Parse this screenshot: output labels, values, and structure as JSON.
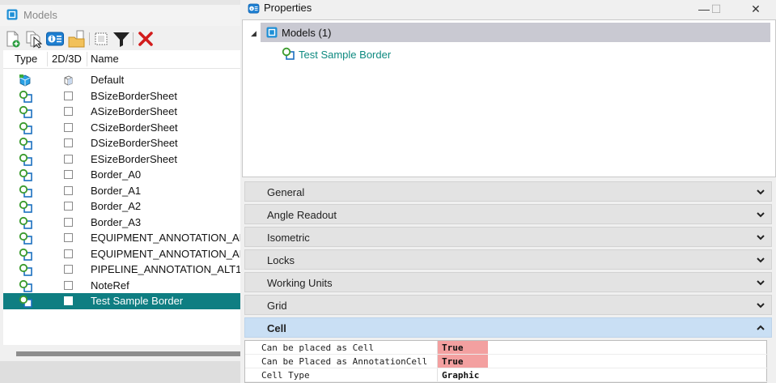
{
  "models_panel": {
    "title": "Models",
    "toolbar": {
      "icons": [
        "new-model-icon",
        "copy-model-icon",
        "properties-icon",
        "import-model-icon",
        "select-all-icon",
        "filter-icon",
        "delete-icon"
      ]
    },
    "columns": {
      "type": "Type",
      "dim": "2D/3D",
      "name": "Name"
    },
    "rows": [
      {
        "name": "Default",
        "type_icon": "design-model-3d-icon",
        "dim": "3d"
      },
      {
        "name": "BSizeBorderSheet",
        "type_icon": "sheet-model-icon",
        "dim": "2d"
      },
      {
        "name": "ASizeBorderSheet",
        "type_icon": "sheet-model-icon",
        "dim": "2d"
      },
      {
        "name": "CSizeBorderSheet",
        "type_icon": "sheet-model-icon",
        "dim": "2d"
      },
      {
        "name": "DSizeBorderSheet",
        "type_icon": "sheet-model-icon",
        "dim": "2d"
      },
      {
        "name": "ESizeBorderSheet",
        "type_icon": "sheet-model-icon",
        "dim": "2d"
      },
      {
        "name": "Border_A0",
        "type_icon": "sheet-model-icon",
        "dim": "2d"
      },
      {
        "name": "Border_A1",
        "type_icon": "sheet-model-icon",
        "dim": "2d"
      },
      {
        "name": "Border_A2",
        "type_icon": "sheet-model-icon",
        "dim": "2d"
      },
      {
        "name": "Border_A3",
        "type_icon": "sheet-model-icon",
        "dim": "2d"
      },
      {
        "name": "EQUIPMENT_ANNOTATION_AL",
        "type_icon": "sheet-model-icon",
        "dim": "2d"
      },
      {
        "name": "EQUIPMENT_ANNOTATION_AL",
        "type_icon": "sheet-model-icon",
        "dim": "2d"
      },
      {
        "name": "PIPELINE_ANNOTATION_ALT1",
        "type_icon": "sheet-model-icon",
        "dim": "2d"
      },
      {
        "name": "NoteRef",
        "type_icon": "sheet-model-icon",
        "dim": "2d"
      },
      {
        "name": "Test Sample Border",
        "type_icon": "sheet-model-icon",
        "dim": "2d",
        "selected": true
      }
    ]
  },
  "properties_panel": {
    "title": "Properties",
    "window_buttons": {
      "minimize": "—",
      "maximize": "☐",
      "close": "✕"
    },
    "tree": {
      "root_label": "Models (1)",
      "child_label": "Test Sample Border"
    },
    "categories": [
      {
        "label": "General",
        "open": false
      },
      {
        "label": "Angle Readout",
        "open": false
      },
      {
        "label": "Isometric",
        "open": false
      },
      {
        "label": "Locks",
        "open": false
      },
      {
        "label": "Working Units",
        "open": false
      },
      {
        "label": "Grid",
        "open": false
      },
      {
        "label": "Cell",
        "open": true
      }
    ],
    "cell_properties": [
      {
        "name": "Can be placed as Cell",
        "value": "True",
        "highlight": true
      },
      {
        "name": "Can be Placed as AnnotationCell",
        "value": "True",
        "highlight": true
      },
      {
        "name": "Cell Type",
        "value": "Graphic",
        "highlight": false
      }
    ]
  },
  "colors": {
    "selection": "#0f7e82",
    "tree_selection": "#c9c9d2",
    "open_category": "#c9dff4",
    "highlight_value": "#f3a0a0",
    "child_text": "#0e8a80"
  }
}
